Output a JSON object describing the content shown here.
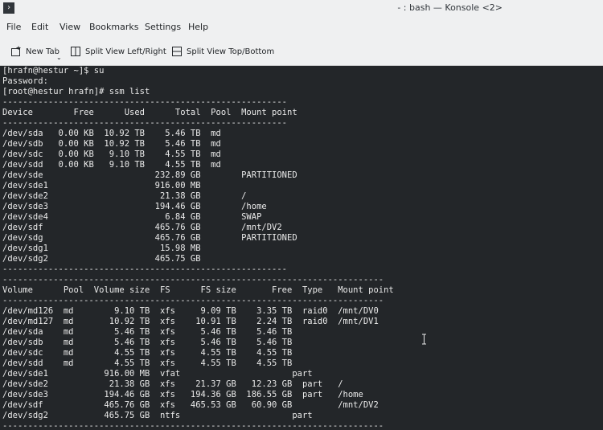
{
  "window": {
    "title": "- : bash — Konsole <2>",
    "app_icon_glyph": "›"
  },
  "menu": [
    "File",
    "Edit",
    "View",
    "Bookmarks",
    "Settings",
    "Help"
  ],
  "toolbar": {
    "new_tab": "New Tab",
    "split_lr": "Split View Left/Right",
    "split_tb": "Split View Top/Bottom"
  },
  "terminal": {
    "fg": "#eaeaea",
    "bg": "#232629",
    "lines": [
      "[hrafn@hestur ~]$ su",
      "Password:",
      "[root@hestur hrafn]# ssm list",
      "--------------------------------------------------------",
      "Device        Free      Used      Total  Pool  Mount point",
      "--------------------------------------------------------",
      "/dev/sda   0.00 KB  10.92 TB    5.46 TB  md",
      "/dev/sdb   0.00 KB  10.92 TB    5.46 TB  md",
      "/dev/sdc   0.00 KB   9.10 TB    4.55 TB  md",
      "/dev/sdd   0.00 KB   9.10 TB    4.55 TB  md",
      "/dev/sde                      232.89 GB        PARTITIONED",
      "/dev/sde1                     916.00 MB",
      "/dev/sde2                      21.38 GB        /",
      "/dev/sde3                     194.46 GB        /home",
      "/dev/sde4                       6.84 GB        SWAP",
      "/dev/sdf                      465.76 GB        /mnt/DV2",
      "/dev/sdg                      465.76 GB        PARTITIONED",
      "/dev/sdg1                      15.98 MB",
      "/dev/sdg2                     465.75 GB",
      "--------------------------------------------------------",
      "---------------------------------------------------------------------------",
      "Volume      Pool  Volume size  FS      FS size       Free  Type   Mount point",
      "---------------------------------------------------------------------------",
      "/dev/md126  md        9.10 TB  xfs     9.09 TB    3.35 TB  raid0  /mnt/DV0",
      "/dev/md127  md       10.92 TB  xfs    10.91 TB    2.24 TB  raid0  /mnt/DV1",
      "/dev/sda    md        5.46 TB  xfs     5.46 TB    5.46 TB",
      "/dev/sdb    md        5.46 TB  xfs     5.46 TB    5.46 TB",
      "/dev/sdc    md        4.55 TB  xfs     4.55 TB    4.55 TB",
      "/dev/sdd    md        4.55 TB  xfs     4.55 TB    4.55 TB",
      "/dev/sde1           916.00 MB  vfat                      part",
      "/dev/sde2            21.38 GB  xfs    21.37 GB   12.23 GB  part   /",
      "/dev/sde3           194.46 GB  xfs   194.36 GB  186.55 GB  part   /home",
      "/dev/sdf            465.76 GB  xfs   465.53 GB   60.90 GB         /mnt/DV2",
      "/dev/sdg2           465.75 GB  ntfs                      part",
      "---------------------------------------------------------------------------"
    ]
  }
}
